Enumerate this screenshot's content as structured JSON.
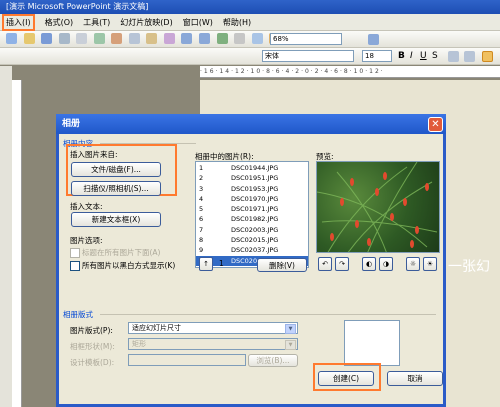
{
  "app": {
    "title": "[演示文稿] Microsoft PowerPoint [演示文稿]",
    "title_visible": "[演示 Microsoft PowerPoint 演示文稿]"
  },
  "menu": [
    "插入(I)",
    "格式(O)",
    "工具(T)",
    "幻灯片放映(D)",
    "窗口(W)",
    "帮助(H)"
  ],
  "toolbar": {
    "zoom": "68%",
    "font": "宋体",
    "size": "18",
    "ruler_marks": "·16·14·12·10·8·6·4·2·0·2·4·6·8·10·12·"
  },
  "slide": {
    "text": "一张幻"
  },
  "dialog": {
    "title": "相册",
    "content_group": "相册内容",
    "insert_from_label": "插入图片来自:",
    "file_disk_button": "文件/磁盘(F)...",
    "scanner_button": "扫描仪/照相机(S)...",
    "insert_text_label": "插入文本:",
    "new_textbox_button": "新建文本框(X)",
    "picture_options_label": "图片选项:",
    "captions_below_label": "标题在所有图片下面(A)",
    "black_white_label": "所有图片以黑白方式显示(K)",
    "pictures_in_album_label": "相册中的图片(R):",
    "pictures": [
      {
        "n": "1",
        "name": "DSC01944.JPG"
      },
      {
        "n": "2",
        "name": "DSC01951.JPG"
      },
      {
        "n": "3",
        "name": "DSC01953.JPG"
      },
      {
        "n": "4",
        "name": "DSC01970.JPG"
      },
      {
        "n": "5",
        "name": "DSC01971.JPG"
      },
      {
        "n": "6",
        "name": "DSC01982.JPG"
      },
      {
        "n": "7",
        "name": "DSC02003.JPG"
      },
      {
        "n": "8",
        "name": "DSC02015.JPG"
      },
      {
        "n": "9",
        "name": "DSC02037.JPG"
      },
      {
        "n": "10",
        "name": "DSC02049.JPG"
      }
    ],
    "selected_index": 9,
    "order_position": "1",
    "delete_button": "删除(V)",
    "preview_label": "预览:",
    "layout_group": "相册版式",
    "picture_layout_label": "图片版式(P):",
    "picture_layout_value": "适应幻灯片尺寸",
    "frame_shape_label": "相框形状(M):",
    "frame_shape_value": "矩形",
    "design_template_label": "设计模板(D):",
    "browse_button": "浏览(B)...",
    "create_button": "创建(C)",
    "cancel_button": "取消"
  },
  "colors": {
    "highlight": "#ff7a2f",
    "selection": "#316ac5",
    "titlebar": "#2a5bc8"
  }
}
